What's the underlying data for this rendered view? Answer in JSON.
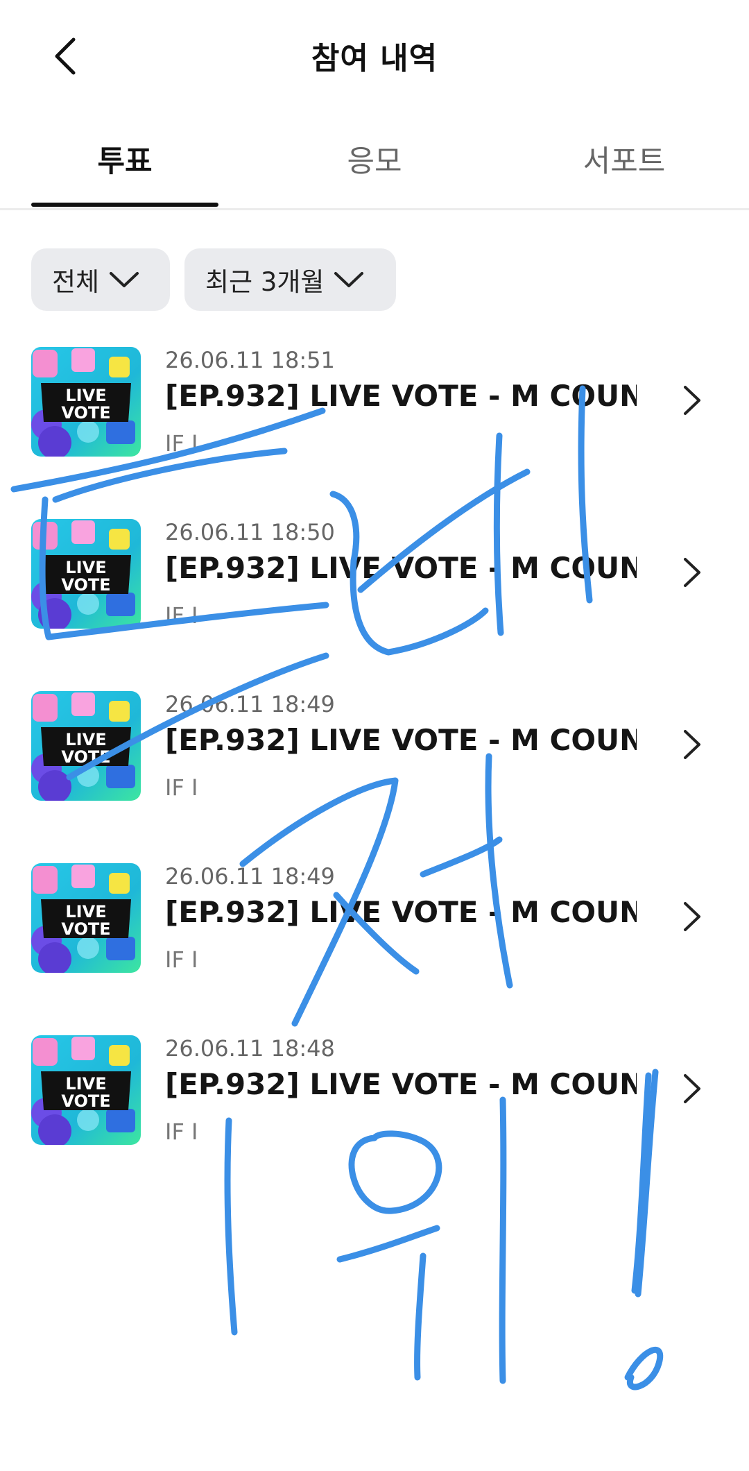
{
  "header": {
    "title": "참여 내역"
  },
  "tabs": [
    {
      "label": "투표",
      "active": true
    },
    {
      "label": "응모",
      "active": false
    },
    {
      "label": "서포트",
      "active": false
    }
  ],
  "filters": {
    "category": "전체",
    "period": "최근 3개월"
  },
  "thumbnail": {
    "line1": "LIVE",
    "line2": "VOTE"
  },
  "items": [
    {
      "date": "26.06.11 18:51",
      "title": "[EP.932] LIVE VOTE - M COUN...",
      "subtitle": "IF I"
    },
    {
      "date": "26.06.11 18:50",
      "title": "[EP.932] LIVE VOTE - M COUN...",
      "subtitle": "IF I"
    },
    {
      "date": "26.06.11 18:49",
      "title": "[EP.932] LIVE VOTE - M COUN...",
      "subtitle": "IF I"
    },
    {
      "date": "26.06.11 18:49",
      "title": "[EP.932] LIVE VOTE - M COUN...",
      "subtitle": "IF I"
    },
    {
      "date": "26.06.11 18:48",
      "title": "[EP.932] LIVE VOTE - M COUN...",
      "subtitle": "IF I"
    }
  ],
  "annotation": {
    "color": "#3b8fe6"
  }
}
